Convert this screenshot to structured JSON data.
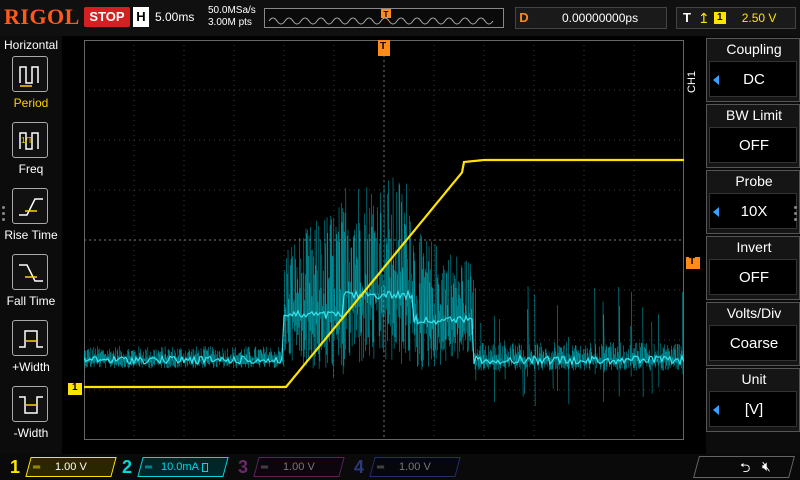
{
  "topbar": {
    "brand": "RIGOL",
    "run_state": "STOP",
    "horizontal_key": "H",
    "timebase": "5.00ms",
    "sample_rate": "50.0MSa/s",
    "memory_depth": "3.00M pts",
    "trigger_marker": "T",
    "delay_key": "D",
    "delay_value": "0.00000000ps",
    "trigger_key": "T",
    "trigger_edge_icon": "rising-edge-icon",
    "trigger_source": "1",
    "trigger_level": "2.50 V"
  },
  "left_menu": {
    "title": "Horizontal",
    "items": [
      {
        "label": "Period",
        "icon": "period-icon"
      },
      {
        "label": "Freq",
        "icon": "freq-icon"
      },
      {
        "label": "Rise Time",
        "icon": "rise-time-icon"
      },
      {
        "label": "Fall Time",
        "icon": "fall-time-icon"
      },
      {
        "label": "+Width",
        "icon": "positive-width-icon"
      },
      {
        "label": "-Width",
        "icon": "negative-width-icon"
      }
    ]
  },
  "right_menu": {
    "channel": "CH1",
    "items": [
      {
        "title": "Coupling",
        "value": "DC",
        "has_arrow": true
      },
      {
        "title": "BW Limit",
        "value": "OFF",
        "has_arrow": false
      },
      {
        "title": "Probe",
        "value": "10X",
        "has_arrow": true
      },
      {
        "title": "Invert",
        "value": "OFF",
        "has_arrow": false
      },
      {
        "title": "Volts/Div",
        "value": "Coarse",
        "has_arrow": false
      },
      {
        "title": "Unit",
        "value": "[V]",
        "has_arrow": true
      }
    ]
  },
  "markers": {
    "ch1_ground": "1",
    "trigger_level": "T",
    "trigger_position": "T"
  },
  "bottom_bar": {
    "channels": [
      {
        "num": "1",
        "coupling_icon": "dc-coupling-icon",
        "scale": "1.00 V",
        "color": "#ffe400",
        "active": true
      },
      {
        "num": "2",
        "coupling_icon": "dc-coupling-icon",
        "scale": "10.0mA",
        "color": "#00d8e0",
        "active": true
      },
      {
        "num": "3",
        "coupling_icon": "dc-coupling-icon",
        "scale": "1.00 V",
        "color": "#c040c0",
        "active": false
      },
      {
        "num": "4",
        "coupling_icon": "dc-coupling-icon",
        "scale": "1.00 V",
        "color": "#3a70ff",
        "active": false
      }
    ],
    "usb_icon": "usb-icon",
    "speaker_icon": "speaker-muted-icon"
  },
  "colors": {
    "ch1": "#ffe400",
    "ch2": "#00d8e0",
    "brand": "#ff5a1a",
    "stop": "#d42020",
    "accent": "#3aa0ff",
    "marker": "#ff8a1a"
  }
}
